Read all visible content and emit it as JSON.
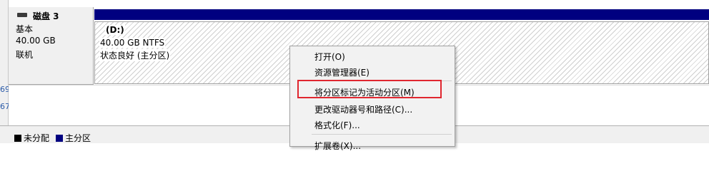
{
  "disk": {
    "title": "磁盘 3",
    "type": "基本",
    "size": "40.00 GB",
    "status": "联机"
  },
  "partition": {
    "name": "(D:)",
    "size_fs": "40.00 GB NTFS",
    "status": "状态良好 (主分区)"
  },
  "left_numbers": [
    "69",
    "67"
  ],
  "context_menu": {
    "items": [
      {
        "label": "打开(O)"
      },
      {
        "label": "资源管理器(E)"
      },
      {
        "label": "将分区标记为活动分区(M)"
      },
      {
        "label": "更改驱动器号和路径(C)..."
      },
      {
        "label": "格式化(F)..."
      },
      {
        "label": "扩展卷(X)..."
      }
    ]
  },
  "legend": {
    "unallocated": "未分配",
    "primary": "主分区"
  },
  "colors": {
    "primary_partition": "#000080",
    "unallocated": "#000000",
    "highlight": "#e0262f"
  }
}
